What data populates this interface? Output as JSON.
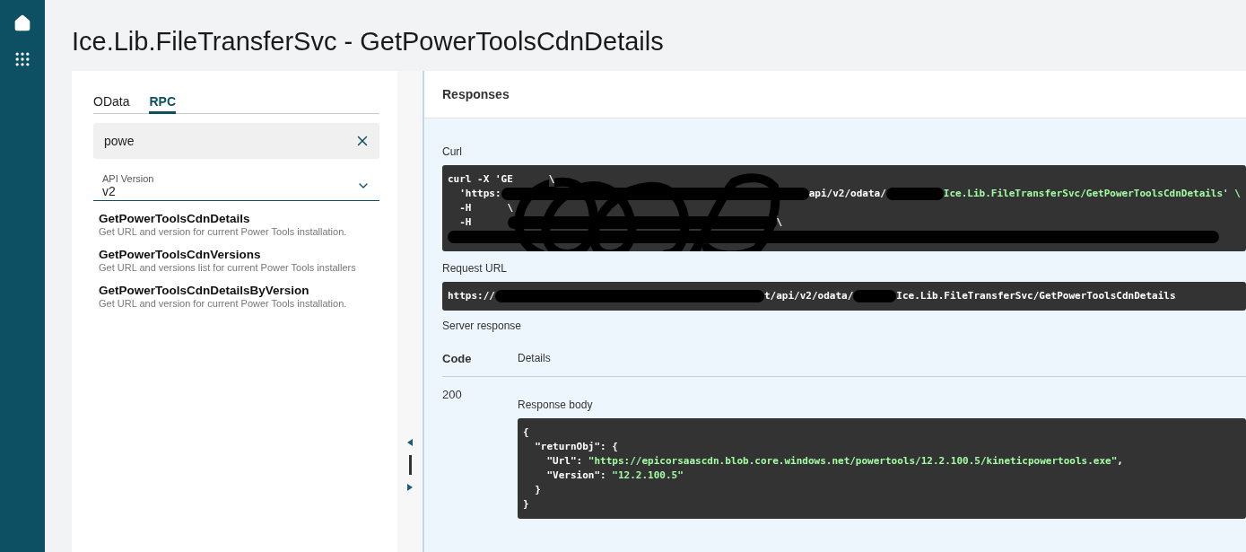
{
  "nav": {
    "items": [
      {
        "kind": "home"
      },
      {
        "kind": "apps"
      }
    ]
  },
  "title": "Ice.Lib.FileTransferSvc - GetPowerToolsCdnDetails",
  "tabs": [
    {
      "label": "OData",
      "selected": false
    },
    {
      "label": "RPC",
      "selected": true
    }
  ],
  "search": {
    "value": "powe"
  },
  "api_version": {
    "label": "API Version",
    "value": "v2"
  },
  "methods": [
    {
      "name": "GetPowerToolsCdnDetails",
      "description": "Get URL and version for current Power Tools installation."
    },
    {
      "name": "GetPowerToolsCdnVersions",
      "description": "Get URL and versions list for current Power Tools installers"
    },
    {
      "name": "GetPowerToolsCdnDetailsByVersion",
      "description": "Get URL and version for current Power Tools installation."
    }
  ],
  "responses": {
    "heading": "Responses",
    "curl_label": "Curl",
    "curl_lines": [
      [
        {
          "kind": "text",
          "text": "curl -X 'GE"
        },
        {
          "kind": "gap"
        },
        {
          "kind": "text",
          "text": "\\"
        }
      ],
      [
        {
          "kind": "text",
          "text": "  'https:"
        },
        {
          "kind": "redacted"
        },
        {
          "kind": "text",
          "text": "api/v2/odata/"
        },
        {
          "kind": "redacted"
        },
        {
          "kind": "text",
          "text": "Ice.Lib.FileTransferSvc/GetPowerToolsCdnDetails' \\"
        }
      ],
      [
        {
          "kind": "text",
          "text": "  -H"
        },
        {
          "kind": "gap"
        },
        {
          "kind": "text",
          "text": "\\"
        }
      ],
      [
        {
          "kind": "text",
          "text": "  -H"
        },
        {
          "kind": "gap"
        },
        {
          "kind": "redacted"
        },
        {
          "kind": "text",
          "text": "\\"
        }
      ],
      [
        {
          "kind": "redacted"
        }
      ]
    ],
    "request_url_label": "Request URL",
    "request_url": [
      {
        "kind": "text",
        "text": "https://"
      },
      {
        "kind": "redacted"
      },
      {
        "kind": "text",
        "text": "t/api/v2/odata/"
      },
      {
        "kind": "redacted"
      },
      {
        "kind": "text",
        "text": "Ice.Lib.FileTransferSvc/GetPowerToolsCdnDetails"
      }
    ],
    "server_response_label": "Server response",
    "columns": [
      "Code",
      "Details"
    ],
    "code": "200",
    "body_label": "Response body",
    "body_lines": [
      [
        {
          "kind": "punct",
          "text": "{"
        }
      ],
      [
        {
          "kind": "punct",
          "text": "  \"returnObj\": {"
        }
      ],
      [
        {
          "kind": "punct",
          "text": "    \"Url\": "
        },
        {
          "kind": "string",
          "text": "\"https://epicorsaascdn.blob.core.windows.net/powertools/12.2.100.5/kineticpowertools.exe\""
        },
        {
          "kind": "punct",
          "text": ","
        }
      ],
      [
        {
          "kind": "punct",
          "text": "    \"Version\": "
        },
        {
          "kind": "string",
          "text": "\"12.2.100.5\""
        }
      ],
      [
        {
          "kind": "punct",
          "text": "  }"
        }
      ],
      [
        {
          "kind": "punct",
          "text": "}"
        }
      ]
    ]
  }
}
